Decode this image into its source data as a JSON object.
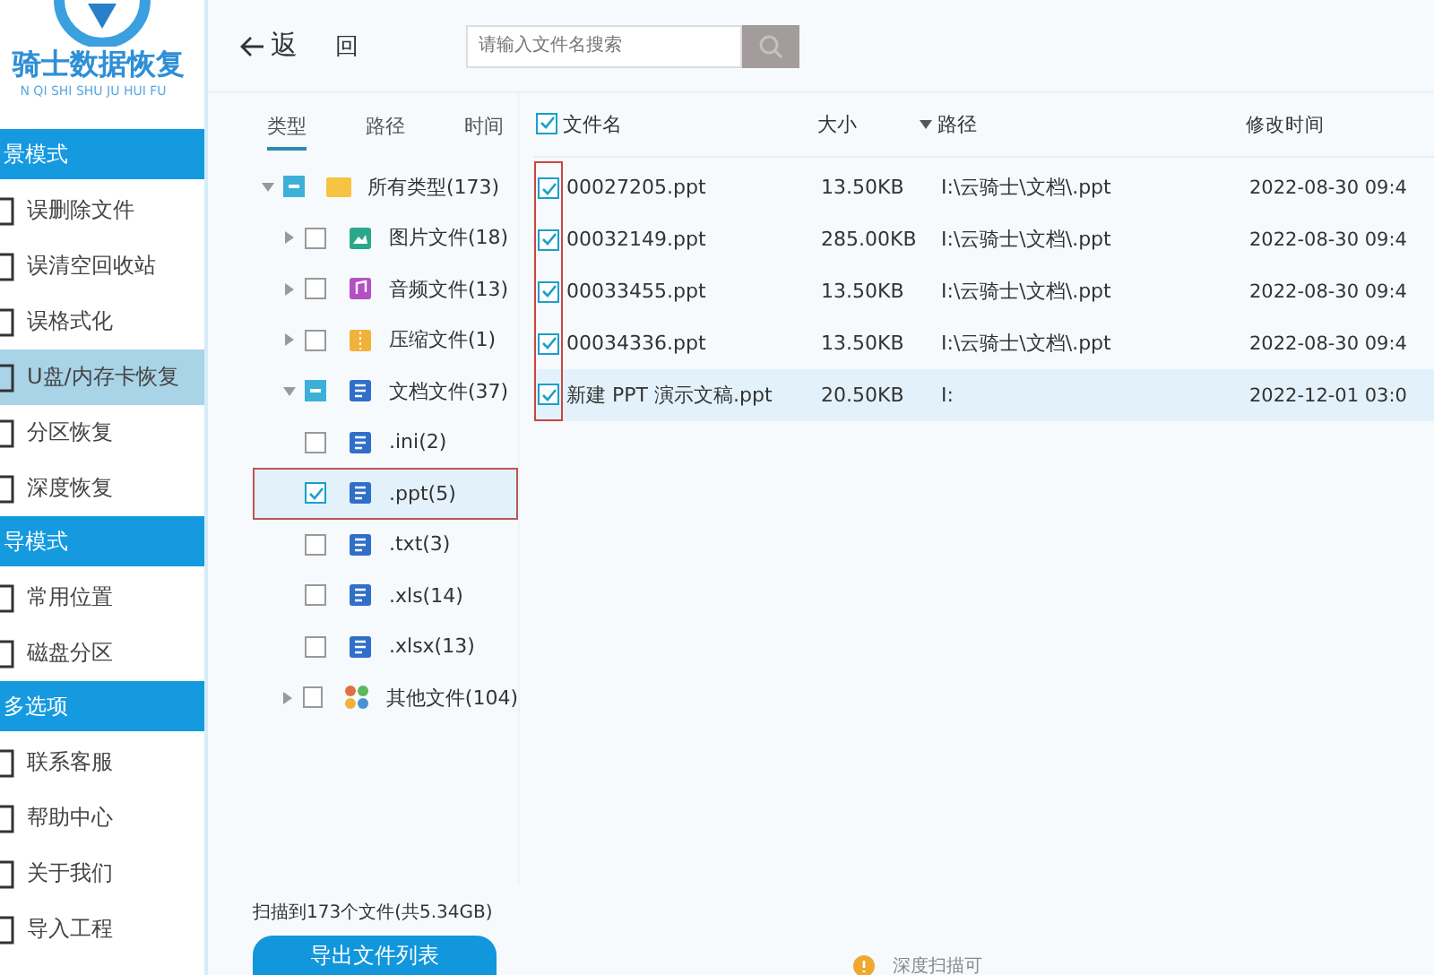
{
  "sidebar": {
    "logo_title": "骑士数据恢复",
    "logo_subtitle": "N QI SHI SHU JU HUI FU",
    "sections": [
      {
        "title": "景模式",
        "items": [
          {
            "label": "误删除文件",
            "selected": false
          },
          {
            "label": "误清空回收站",
            "selected": false
          },
          {
            "label": "误格式化",
            "selected": false
          },
          {
            "label": "U盘/内存卡恢复",
            "selected": true
          },
          {
            "label": "分区恢复",
            "selected": false
          },
          {
            "label": "深度恢复",
            "selected": false
          }
        ]
      },
      {
        "title": "导模式",
        "items": [
          {
            "label": "常用位置",
            "selected": false
          },
          {
            "label": "磁盘分区",
            "selected": false
          }
        ]
      },
      {
        "title": "多选项",
        "items": [
          {
            "label": "联系客服",
            "selected": false
          },
          {
            "label": "帮助中心",
            "selected": false
          },
          {
            "label": "关于我们",
            "selected": false
          },
          {
            "label": "导入工程",
            "selected": false
          }
        ]
      }
    ]
  },
  "toolbar": {
    "back_label": "返",
    "back_label_2": "回",
    "search": {
      "placeholder": "请输入文件名搜索"
    }
  },
  "tabs": [
    {
      "label": "类型",
      "selected": true
    },
    {
      "label": "路径",
      "selected": false
    },
    {
      "label": "时间",
      "selected": false
    }
  ],
  "tree": [
    {
      "label": "所有类型(173)",
      "kind": "folder",
      "checked": false,
      "partial": true,
      "expanded": true,
      "selected": false,
      "children": [
        {
          "label": "图片文件(18)",
          "kind": "image",
          "checked": false,
          "partial": false,
          "expanded": false,
          "selected": false
        },
        {
          "label": "音频文件(13)",
          "kind": "audio",
          "checked": false,
          "partial": false,
          "expanded": false,
          "selected": false
        },
        {
          "label": "压缩文件(1)",
          "kind": "zip",
          "checked": false,
          "partial": false,
          "expanded": false,
          "selected": false
        },
        {
          "label": "文档文件(37)",
          "kind": "doc",
          "checked": false,
          "partial": true,
          "expanded": true,
          "selected": false,
          "children": [
            {
              "label": ".ini(2)",
              "kind": "doc",
              "checked": false,
              "selected": false
            },
            {
              "label": ".ppt(5)",
              "kind": "doc",
              "checked": true,
              "selected": true
            },
            {
              "label": ".txt(3)",
              "kind": "doc",
              "checked": false,
              "selected": false
            },
            {
              "label": ".xls(14)",
              "kind": "doc",
              "checked": false,
              "selected": false
            },
            {
              "label": ".xlsx(13)",
              "kind": "doc",
              "checked": false,
              "selected": false
            }
          ]
        },
        {
          "label": "其他文件(104)",
          "kind": "other",
          "checked": false,
          "partial": false,
          "expanded": false,
          "selected": false
        }
      ]
    }
  ],
  "table": {
    "all_checked": true,
    "columns": [
      {
        "label": "文件名",
        "sorted": false
      },
      {
        "label": "大小",
        "sorted": false
      },
      {
        "label": "路径",
        "sorted": true
      },
      {
        "label": "修改时间",
        "sorted": false
      }
    ],
    "rows": [
      {
        "checked": true,
        "selected": false,
        "cells": [
          "00027205.ppt",
          "13.50KB",
          "I:\\云骑士\\文档\\.ppt",
          "2022-08-30 09:4"
        ]
      },
      {
        "checked": true,
        "selected": false,
        "cells": [
          "00032149.ppt",
          "285.00KB",
          "I:\\云骑士\\文档\\.ppt",
          "2022-08-30 09:4"
        ]
      },
      {
        "checked": true,
        "selected": false,
        "cells": [
          "00033455.ppt",
          "13.50KB",
          "I:\\云骑士\\文档\\.ppt",
          "2022-08-30 09:4"
        ]
      },
      {
        "checked": true,
        "selected": false,
        "cells": [
          "00034336.ppt",
          "13.50KB",
          "I:\\云骑士\\文档\\.ppt",
          "2022-08-30 09:4"
        ]
      },
      {
        "checked": true,
        "selected": true,
        "cells": [
          "新建 PPT 演示文稿.ppt",
          "20.50KB",
          "I:",
          "2022-12-01 03:0"
        ]
      }
    ]
  },
  "footer": {
    "summary": "扫描到173个文件(共5.34GB)",
    "export_button": "导出文件列表",
    "hint": "深度扫描可"
  }
}
